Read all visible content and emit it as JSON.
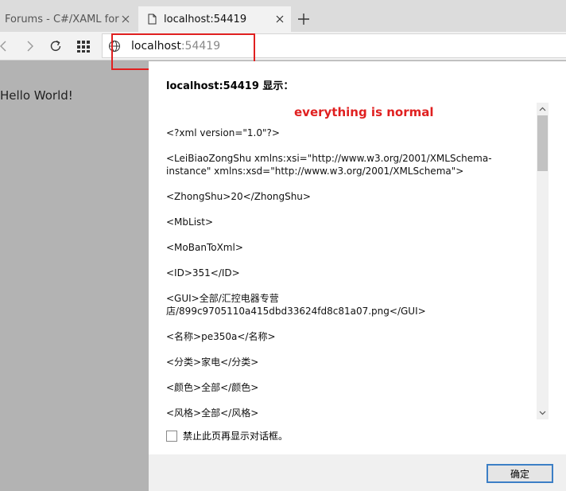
{
  "tabs": [
    {
      "label": "Forums - C#/XAML for H",
      "active": false
    },
    {
      "label": "localhost:54419",
      "active": true
    }
  ],
  "address": {
    "host": "localhost",
    "port": ":54419"
  },
  "page": {
    "hello_text": "Hello World!"
  },
  "dialog": {
    "title": "localhost:54419 显示：",
    "message_heading": "everything is normal",
    "message_lines": [
      "<?xml version=\"1.0\"?>",
      "<LeiBiaoZongShu xmlns:xsi=\"http://www.w3.org/2001/XMLSchema-instance\" xmlns:xsd=\"http://www.w3.org/2001/XMLSchema\">",
      "  <ZhongShu>20</ZhongShu>",
      "  <MbList>",
      "    <MoBanToXml>",
      "      <ID>351</ID>",
      "      <GUI>全部/汇控电器专营店/899c9705110a415dbd33624fd8c81a07.png</GUI>",
      "      <名称>pe350a</名称>",
      "      <分类>家电</分类>",
      "      <颜色>全部</颜色>",
      "      <风格>全部</风格>"
    ],
    "checkbox_label": "禁止此页再显示对话框。",
    "ok_label": "确定"
  },
  "colors": {
    "accent_red": "#e02020",
    "button_border": "#3c7fc6"
  },
  "icons": [
    "back-icon",
    "forward-icon",
    "refresh-icon",
    "apps-grid-icon",
    "globe-icon",
    "close-icon",
    "plus-icon",
    "page-icon"
  ]
}
